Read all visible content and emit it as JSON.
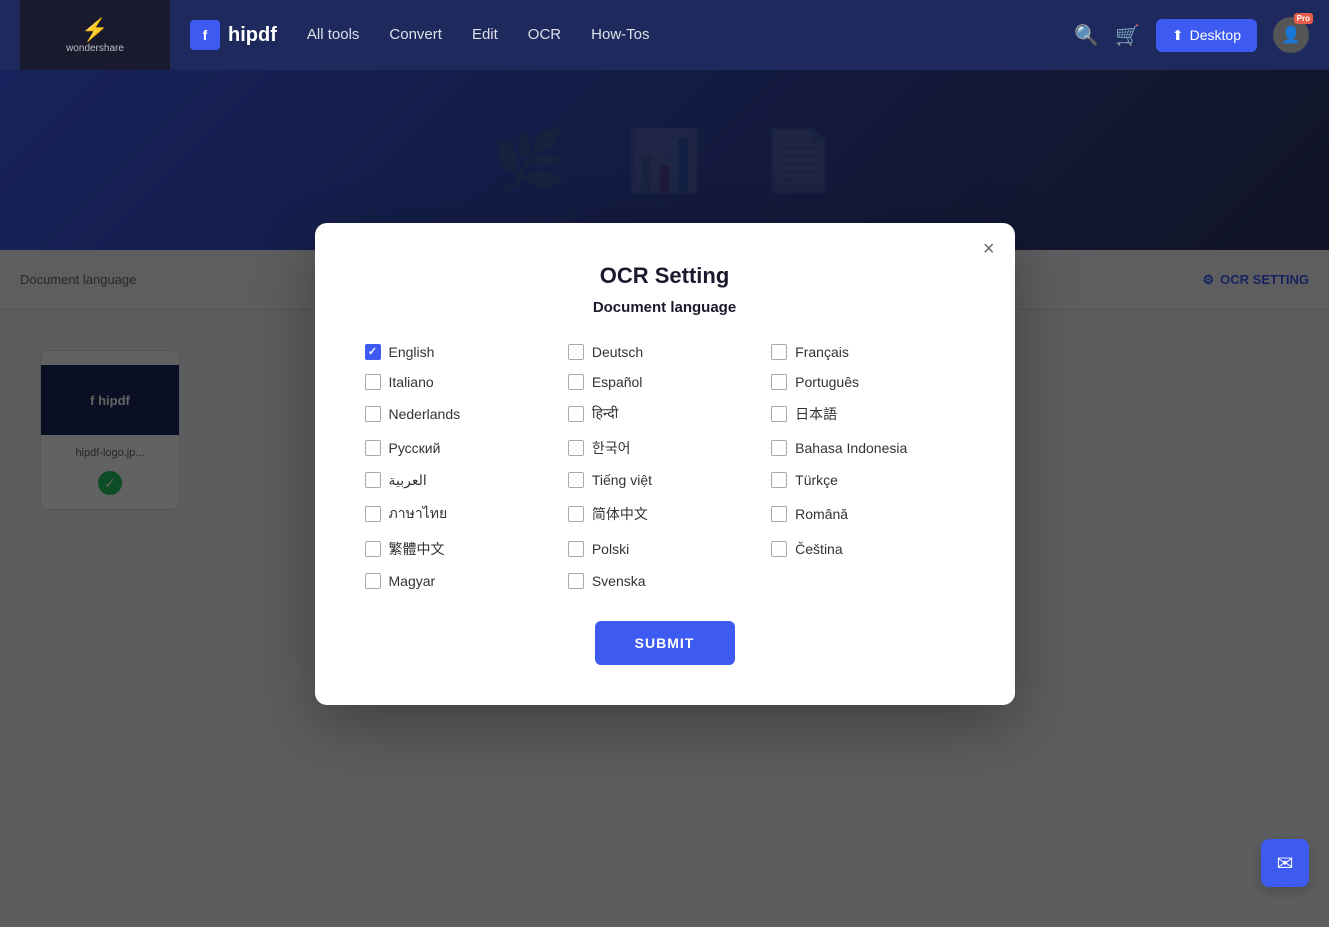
{
  "navbar": {
    "brand": "hipdf",
    "wondershare_label": "wondershare",
    "nav_items": [
      "All tools",
      "Convert",
      "Edit",
      "OCR",
      "How-Tos"
    ],
    "desktop_btn": "Desktop",
    "pro_label": "Pro"
  },
  "modal": {
    "title": "OCR Setting",
    "subtitle": "Document language",
    "close_label": "×",
    "submit_label": "SUBMIT",
    "languages": [
      {
        "id": "english",
        "label": "English",
        "checked": true,
        "col": 1
      },
      {
        "id": "deutsch",
        "label": "Deutsch",
        "checked": false,
        "col": 2
      },
      {
        "id": "francais",
        "label": "Français",
        "checked": false,
        "col": 3
      },
      {
        "id": "italiano",
        "label": "Italiano",
        "checked": false,
        "col": 1
      },
      {
        "id": "espanol",
        "label": "Español",
        "checked": false,
        "col": 2
      },
      {
        "id": "portugues",
        "label": "Português",
        "checked": false,
        "col": 3
      },
      {
        "id": "nederlands",
        "label": "Nederlands",
        "checked": false,
        "col": 1
      },
      {
        "id": "hindi",
        "label": "हिन्दी",
        "checked": false,
        "col": 2
      },
      {
        "id": "japanese",
        "label": "日本語",
        "checked": false,
        "col": 3
      },
      {
        "id": "russian",
        "label": "Русский",
        "checked": false,
        "col": 1
      },
      {
        "id": "korean",
        "label": "한국어",
        "checked": false,
        "col": 2
      },
      {
        "id": "bahasa",
        "label": "Bahasa Indonesia",
        "checked": false,
        "col": 3
      },
      {
        "id": "arabic",
        "label": "العربية",
        "checked": false,
        "col": 1
      },
      {
        "id": "vietnamese",
        "label": "Tiếng việt",
        "checked": false,
        "col": 2
      },
      {
        "id": "turkish",
        "label": "Türkçe",
        "checked": false,
        "col": 3
      },
      {
        "id": "thai",
        "label": "ภาษาไทย",
        "checked": false,
        "col": 1
      },
      {
        "id": "simplified-chinese",
        "label": "简体中文",
        "checked": false,
        "col": 2
      },
      {
        "id": "romanian",
        "label": "Română",
        "checked": false,
        "col": 3
      },
      {
        "id": "traditional-chinese",
        "label": "繁體中文",
        "checked": false,
        "col": 1
      },
      {
        "id": "polish",
        "label": "Polski",
        "checked": false,
        "col": 2
      },
      {
        "id": "czech",
        "label": "Čeština",
        "checked": false,
        "col": 3
      },
      {
        "id": "magyar",
        "label": "Magyar",
        "checked": false,
        "col": 1
      },
      {
        "id": "swedish",
        "label": "Svenska",
        "checked": false,
        "col": 2
      }
    ]
  },
  "background": {
    "file_name": "hipdf-logo.jp...",
    "ocr_setting_label": "OCR SETTING",
    "doc_lang_label": "Document language"
  },
  "colors": {
    "primary": "#3d5af1",
    "dark_navy": "#1e2a5e",
    "pro_red": "#e85d4a"
  }
}
